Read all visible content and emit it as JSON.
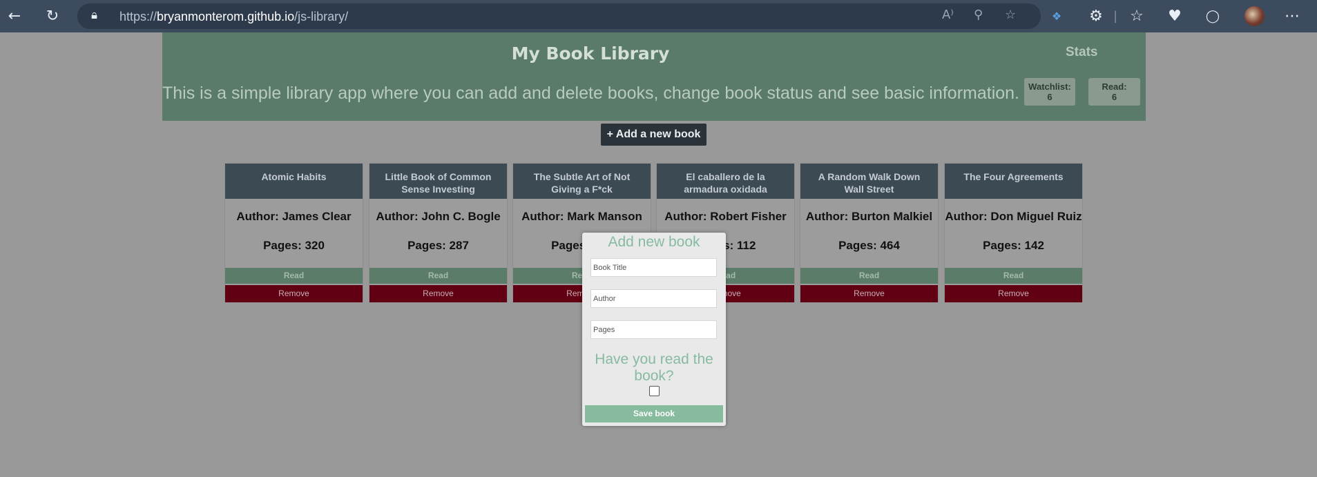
{
  "browser": {
    "url_prefix": "https://",
    "url_host": "bryanmonterom.github.io",
    "url_path": "/js-library/"
  },
  "header": {
    "title": "My Book Library",
    "description": "This is a simple library app where you can add and delete books, change book status and see basic information.",
    "stats_title": "Stats",
    "watchlist_label": "Watchlist:",
    "watchlist_value": "6",
    "read_label": "Read:",
    "read_value": "6"
  },
  "add_button_label": "+ Add a new book",
  "books": [
    {
      "title": "Atomic Habits",
      "author": "Author: James Clear",
      "pages": "Pages: 320",
      "read_label": "Read",
      "remove_label": "Remove"
    },
    {
      "title": "Little Book of Common Sense Investing",
      "author": "Author: John C. Bogle",
      "pages": "Pages: 287",
      "read_label": "Read",
      "remove_label": "Remove"
    },
    {
      "title": "The Subtle Art of Not Giving a F*ck",
      "author": "Author: Mark Manson",
      "pages": "Pages: 224",
      "read_label": "Read",
      "remove_label": "Remove"
    },
    {
      "title": "El caballero de la armadura oxidada",
      "author": "Author: Robert Fisher",
      "pages": "Pages: 112",
      "read_label": "Read",
      "remove_label": "Remove"
    },
    {
      "title": "A Random Walk Down Wall Street",
      "author": "Author: Burton Malkiel",
      "pages": "Pages: 464",
      "read_label": "Read",
      "remove_label": "Remove"
    },
    {
      "title": "The Four Agreements",
      "author": "Author: Don Miguel Ruiz",
      "pages": "Pages: 142",
      "read_label": "Read",
      "remove_label": "Remove"
    }
  ],
  "modal": {
    "title": "Add new book",
    "title_placeholder": "Book Title",
    "author_placeholder": "Author",
    "pages_placeholder": "Pages",
    "question": "Have you read the book?",
    "read_checked": false,
    "save_label": "Save book"
  },
  "icons": [
    "back-icon",
    "refresh-icon",
    "lock-icon",
    "read-aloud-icon",
    "zoom-out-icon",
    "add-favorite-icon",
    "extension-puzzle-icon",
    "favorites-icon",
    "health-icon",
    "browser-essentials-icon",
    "profile-avatar",
    "more-menu-icon"
  ]
}
